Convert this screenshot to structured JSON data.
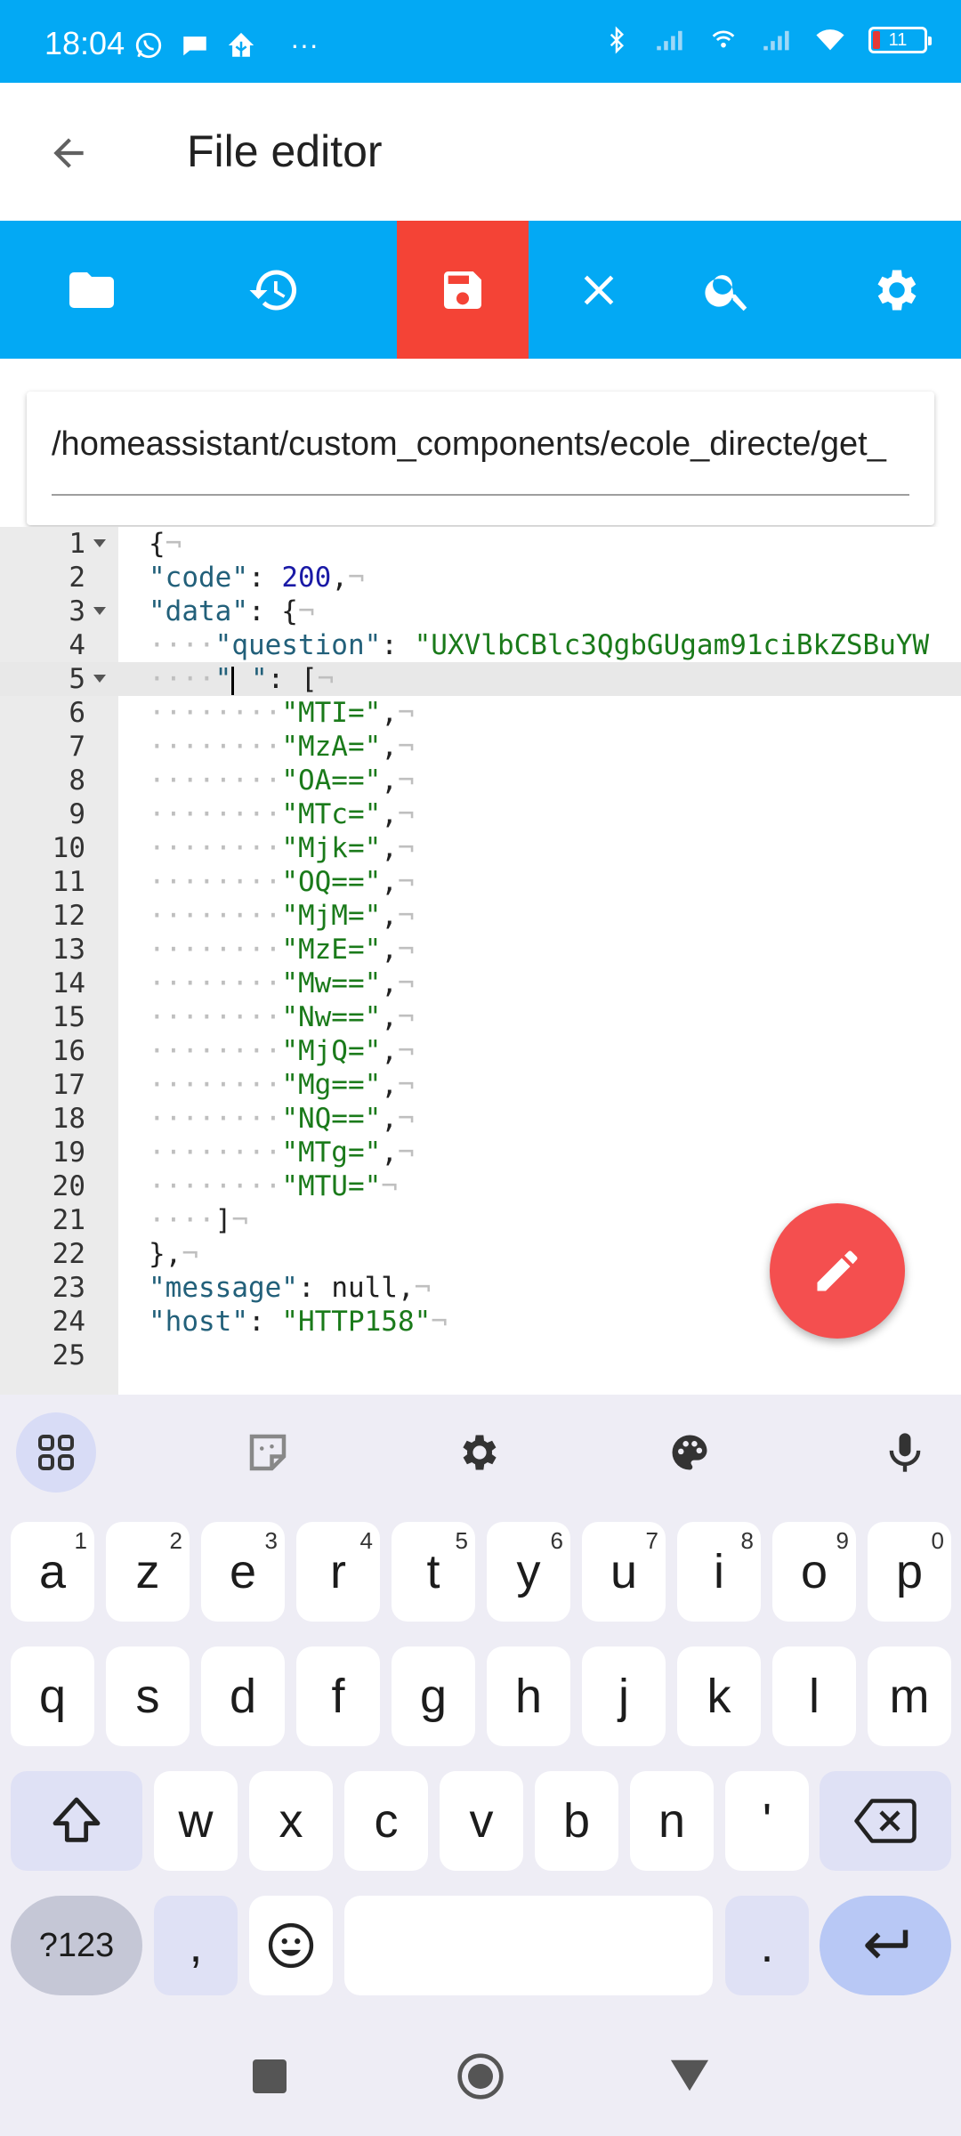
{
  "status_bar": {
    "time": "18:04",
    "more": "···",
    "battery": "11",
    "icons_left": [
      "whatsapp-icon",
      "chat-icon",
      "home-assistant-icon"
    ],
    "icons_right": [
      "bluetooth-icon",
      "signal-icon",
      "hotspot-icon",
      "signal-2-icon",
      "wifi-icon",
      "battery-icon"
    ]
  },
  "app_bar": {
    "title": "File editor"
  },
  "toolbar": {
    "buttons": [
      "folder-icon",
      "history-icon",
      "save-icon",
      "close-icon",
      "search-icon",
      "settings-icon"
    ],
    "active_color": "#f44336"
  },
  "path": {
    "value": "/homeassistant/custom_components/ecole_directe/get_"
  },
  "editor": {
    "active_line": 5,
    "lines": [
      {
        "n": "1"
      },
      {
        "n": "2"
      },
      {
        "n": "3"
      },
      {
        "n": "4"
      },
      {
        "n": "5"
      },
      {
        "n": "6"
      },
      {
        "n": "7"
      },
      {
        "n": "8"
      },
      {
        "n": "9"
      },
      {
        "n": "10"
      },
      {
        "n": "11"
      },
      {
        "n": "12"
      },
      {
        "n": "13"
      },
      {
        "n": "14"
      },
      {
        "n": "15"
      },
      {
        "n": "16"
      },
      {
        "n": "17"
      },
      {
        "n": "18"
      },
      {
        "n": "19"
      },
      {
        "n": "20"
      },
      {
        "n": "21"
      },
      {
        "n": "22"
      },
      {
        "n": "23"
      },
      {
        "n": "24"
      },
      {
        "n": "25"
      }
    ],
    "code": {
      "l2_key": "\"code\"",
      "l2_val": "200",
      "l3_key": "\"data\"",
      "l4_key": "\"question\"",
      "l4_val": "\"UXVlbCBlc3QgbGUgam91ciBkZSBuYW",
      "l5_key_a": "\"",
      "l5_key_b": " \"",
      "propositions": [
        "\"MTI=\"",
        "\"MzA=\"",
        "\"OA==\"",
        "\"MTc=\"",
        "\"Mjk=\"",
        "\"OQ==\"",
        "\"MjM=\"",
        "\"MzE=\"",
        "\"Mw==\"",
        "\"Nw==\"",
        "\"MjQ=\"",
        "\"Mg==\"",
        "\"NQ==\"",
        "\"MTg=\"",
        "\"MTU=\""
      ],
      "l23_key": "\"message\"",
      "l23_val": "null",
      "l24_key": "\"host\"",
      "l24_val": "\"HTTP158\""
    }
  },
  "keyboard": {
    "row1": [
      [
        "a",
        "1"
      ],
      [
        "z",
        "2"
      ],
      [
        "e",
        "3"
      ],
      [
        "r",
        "4"
      ],
      [
        "t",
        "5"
      ],
      [
        "y",
        "6"
      ],
      [
        "u",
        "7"
      ],
      [
        "i",
        "8"
      ],
      [
        "o",
        "9"
      ],
      [
        "p",
        "0"
      ]
    ],
    "row2": [
      "q",
      "s",
      "d",
      "f",
      "g",
      "h",
      "j",
      "k",
      "l",
      "m"
    ],
    "row3": [
      "w",
      "x",
      "c",
      "v",
      "b",
      "n",
      "'"
    ],
    "sym_label": "?123",
    "comma": ",",
    "period": "."
  }
}
